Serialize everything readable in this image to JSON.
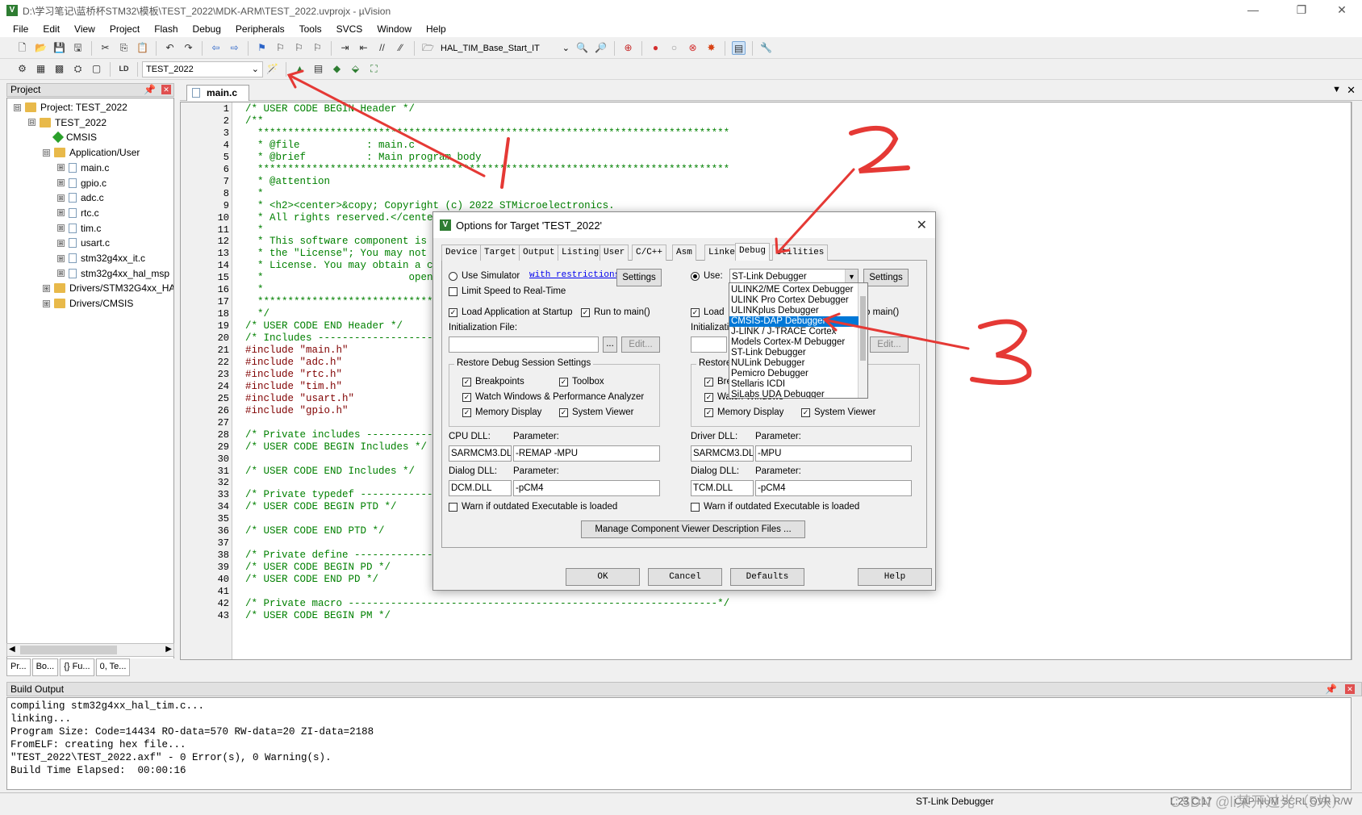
{
  "window": {
    "title": "D:\\学习笔记\\蓝桥杯STM32\\模板\\TEST_2022\\MDK-ARM\\TEST_2022.uvprojx - µVision",
    "minimize": "—",
    "maximize": "❐",
    "close": "✕"
  },
  "menu": [
    "File",
    "Edit",
    "View",
    "Project",
    "Flash",
    "Debug",
    "Peripherals",
    "Tools",
    "SVCS",
    "Window",
    "Help"
  ],
  "toolbar1": {
    "function_combo": "HAL_TIM_Base_Start_IT"
  },
  "toolbar2": {
    "target_combo": "TEST_2022"
  },
  "project": {
    "header": "Project",
    "tree": [
      {
        "label": "Project: TEST_2022",
        "level": 0,
        "kind": "root",
        "exp": "⊟"
      },
      {
        "label": "TEST_2022",
        "level": 1,
        "kind": "folder",
        "exp": "⊟"
      },
      {
        "label": "CMSIS",
        "level": 2,
        "kind": "gem",
        "exp": ""
      },
      {
        "label": "Application/User",
        "level": 2,
        "kind": "folder",
        "exp": "⊟"
      },
      {
        "label": "main.c",
        "level": 3,
        "kind": "file",
        "exp": "⊞"
      },
      {
        "label": "gpio.c",
        "level": 3,
        "kind": "file",
        "exp": "⊞"
      },
      {
        "label": "adc.c",
        "level": 3,
        "kind": "file",
        "exp": "⊞"
      },
      {
        "label": "rtc.c",
        "level": 3,
        "kind": "file",
        "exp": "⊞"
      },
      {
        "label": "tim.c",
        "level": 3,
        "kind": "file",
        "exp": "⊞"
      },
      {
        "label": "usart.c",
        "level": 3,
        "kind": "file",
        "exp": "⊞"
      },
      {
        "label": "stm32g4xx_it.c",
        "level": 3,
        "kind": "file",
        "exp": "⊞"
      },
      {
        "label": "stm32g4xx_hal_msp",
        "level": 3,
        "kind": "file",
        "exp": "⊞"
      },
      {
        "label": "Drivers/STM32G4xx_HA",
        "level": 2,
        "kind": "folder",
        "exp": "⊞"
      },
      {
        "label": "Drivers/CMSIS",
        "level": 2,
        "kind": "folder",
        "exp": "⊞"
      }
    ],
    "bottom_tabs": [
      "Pr...",
      "Bo...",
      "{} Fu...",
      "0, Te..."
    ]
  },
  "editor": {
    "tab": "main.c",
    "lines": [
      {
        "n": "1",
        "t": "/* USER CODE BEGIN Header */",
        "c": "c-comment"
      },
      {
        "n": "2",
        "t": "/**",
        "c": "c-comment"
      },
      {
        "n": "3",
        "t": "  ******************************************************************************",
        "c": "c-comment"
      },
      {
        "n": "4",
        "t": "  * @file           : main.c",
        "c": "c-comment"
      },
      {
        "n": "5",
        "t": "  * @brief          : Main program body",
        "c": "c-comment"
      },
      {
        "n": "6",
        "t": "  ******************************************************************************",
        "c": "c-comment"
      },
      {
        "n": "7",
        "t": "  * @attention",
        "c": "c-comment"
      },
      {
        "n": "8",
        "t": "  *",
        "c": "c-comment"
      },
      {
        "n": "9",
        "t": "  * <h2><center>&copy; Copyright (c) 2022 STMicroelectronics.",
        "c": "c-comment"
      },
      {
        "n": "10",
        "t": "  * All rights reserved.</center></h2>",
        "c": "c-comment"
      },
      {
        "n": "11",
        "t": "  *",
        "c": "c-comment"
      },
      {
        "n": "12",
        "t": "  * This software component is licensed by ST under BSD 3-Clause license,",
        "c": "c-comment"
      },
      {
        "n": "13",
        "t": "  * the \"License\"; You may not use this file except in compliance with the",
        "c": "c-comment"
      },
      {
        "n": "14",
        "t": "  * License. You may obtain a copy of the License at:",
        "c": "c-comment"
      },
      {
        "n": "15",
        "t": "  *                        opensource.org/licenses/BSD-3-Clause",
        "c": "c-comment"
      },
      {
        "n": "16",
        "t": "  *",
        "c": "c-comment"
      },
      {
        "n": "17",
        "t": "  ******************************************************************************",
        "c": "c-comment"
      },
      {
        "n": "18",
        "t": "  */",
        "c": "c-comment"
      },
      {
        "n": "19",
        "t": "/* USER CODE END Header */",
        "c": "c-comment"
      },
      {
        "n": "20",
        "t": "/* Includes ------------------------------------------------------------------*/",
        "c": "c-comment"
      },
      {
        "n": "21",
        "t": "#include \"main.h\"",
        "c": "c-pp"
      },
      {
        "n": "22",
        "t": "#include \"adc.h\"",
        "c": "c-pp"
      },
      {
        "n": "23",
        "t": "#include \"rtc.h\"",
        "c": "c-pp"
      },
      {
        "n": "24",
        "t": "#include \"tim.h\"",
        "c": "c-pp"
      },
      {
        "n": "25",
        "t": "#include \"usart.h\"",
        "c": "c-pp"
      },
      {
        "n": "26",
        "t": "#include \"gpio.h\"",
        "c": "c-pp"
      },
      {
        "n": "27",
        "t": "",
        "c": ""
      },
      {
        "n": "28",
        "t": "/* Private includes ----------------------------------------------------------*/",
        "c": "c-comment"
      },
      {
        "n": "29",
        "t": "/* USER CODE BEGIN Includes */",
        "c": "c-comment"
      },
      {
        "n": "30",
        "t": "",
        "c": ""
      },
      {
        "n": "31",
        "t": "/* USER CODE END Includes */",
        "c": "c-comment"
      },
      {
        "n": "32",
        "t": "",
        "c": ""
      },
      {
        "n": "33",
        "t": "/* Private typedef -----------------------------------------------------------*/",
        "c": "c-comment"
      },
      {
        "n": "34",
        "t": "/* USER CODE BEGIN PTD */",
        "c": "c-comment"
      },
      {
        "n": "35",
        "t": "",
        "c": ""
      },
      {
        "n": "36",
        "t": "/* USER CODE END PTD */",
        "c": "c-comment"
      },
      {
        "n": "37",
        "t": "",
        "c": ""
      },
      {
        "n": "38",
        "t": "/* Private define ------------------------------------------------------------*/",
        "c": "c-comment"
      },
      {
        "n": "39",
        "t": "/* USER CODE BEGIN PD */",
        "c": "c-comment"
      },
      {
        "n": "40",
        "t": "/* USER CODE END PD */",
        "c": "c-comment"
      },
      {
        "n": "41",
        "t": "",
        "c": ""
      },
      {
        "n": "42",
        "t": "/* Private macro -------------------------------------------------------------*/",
        "c": "c-comment"
      },
      {
        "n": "43",
        "t": "/* USER CODE BEGIN PM */",
        "c": "c-comment"
      }
    ]
  },
  "build": {
    "header": "Build Output",
    "text": "compiling stm32g4xx_hal_tim.c...\nlinking...\nProgram Size: Code=14434 RO-data=570 RW-data=20 ZI-data=2188\nFromELF: creating hex file...\n\"TEST_2022\\TEST_2022.axf\" - 0 Error(s), 0 Warning(s).\nBuild Time Elapsed:  00:00:16"
  },
  "status": {
    "debugger": "ST-Link Debugger",
    "position": "L:23 C:17",
    "flags": "CAP  NUM  SCRL  OVR  R/W"
  },
  "dialog": {
    "title": "Options for Target 'TEST_2022'",
    "tabs": [
      "Device",
      "Target",
      "Output",
      "Listing",
      "User",
      "C/C++",
      "Asm",
      "Linker",
      "Debug",
      "Utilities"
    ],
    "left": {
      "use_simulator": "Use Simulator",
      "with_restrictions": "with restrictions",
      "settings": "Settings",
      "limit_speed": "Limit Speed to Real-Time",
      "load_app": "Load Application at Startup",
      "run_main": "Run to main()",
      "init_file": "Initialization File:",
      "browse": "...",
      "edit": "Edit...",
      "restore_group": "Restore Debug Session Settings",
      "breakpoints": "Breakpoints",
      "toolbox": "Toolbox",
      "watch": "Watch Windows & Performance Analyzer",
      "memory": "Memory Display",
      "sysviewer": "System Viewer",
      "cpu_dll_label": "CPU DLL:",
      "param_label": "Parameter:",
      "cpu_dll": "SARMCM3.DLL",
      "cpu_param": "-REMAP -MPU",
      "dialog_dll_label": "Dialog DLL:",
      "dialog_dll": "DCM.DLL",
      "dialog_param": "-pCM4",
      "warn": "Warn if outdated Executable is loaded"
    },
    "right": {
      "use": "Use:",
      "selected": "ST-Link Debugger",
      "settings": "Settings",
      "load": "Load",
      "run_main": "o main()",
      "init_file": "Initializatio",
      "edit": "Edit...",
      "restore": "Restore",
      "breakpoints": "Bre",
      "watch": "Watch Windows",
      "memory": "Memory Display",
      "sysviewer": "System Viewer",
      "driver_dll_label": "Driver DLL:",
      "param_label": "Parameter:",
      "driver_dll": "SARMCM3.DLL",
      "driver_param": "-MPU",
      "dialog_dll_label": "Dialog DLL:",
      "dialog_dll": "TCM.DLL",
      "dialog_param": "-pCM4",
      "warn": "Warn if outdated Executable is loaded"
    },
    "dropdown": [
      "ULINK2/ME Cortex Debugger",
      "ULINK Pro Cortex Debugger",
      "ULINKplus Debugger",
      "CMSIS-DAP Debugger",
      "J-LINK / J-TRACE Cortex",
      "Models Cortex-M Debugger",
      "ST-Link Debugger",
      "NULink Debugger",
      "Pemicro Debugger",
      "Stellaris ICDI",
      "SiLabs UDA Debugger"
    ],
    "dropdown_selected_index": 3,
    "manage": "Manage Component Viewer Description Files ...",
    "ok": "OK",
    "cancel": "Cancel",
    "defaults": "Defaults",
    "help": "Help"
  },
  "watermark": "CSDN @li某开过光（5块）",
  "colors": {
    "annotation": "#e53935",
    "selection": "#0078d7",
    "comment": "#008000"
  }
}
